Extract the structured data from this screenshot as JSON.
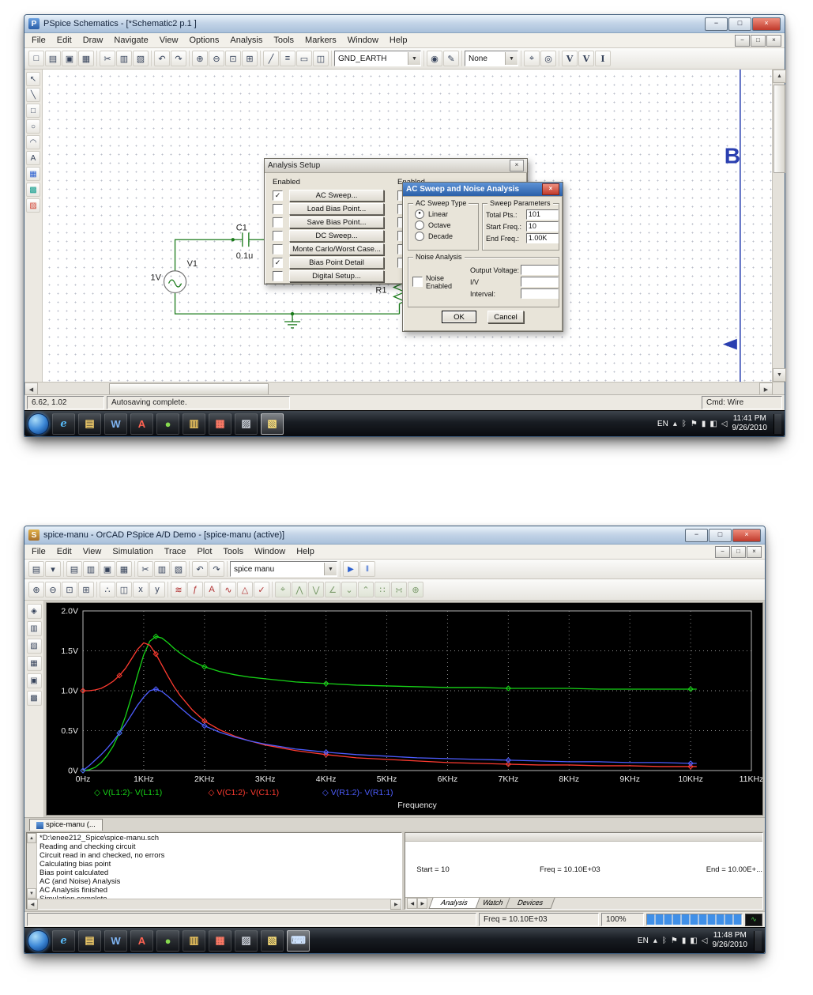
{
  "chart_data": {
    "type": "line",
    "title": "",
    "xlabel": "Frequency",
    "ylabel": "",
    "xlim": [
      0,
      11
    ],
    "ylim": [
      0,
      2
    ],
    "grid": "dotted",
    "legend_position": "bottom-inside",
    "plot_bg": "#000000",
    "x_ticks": [
      "0Hz",
      "1KHz",
      "2KHz",
      "3KHz",
      "4KHz",
      "5KHz",
      "6KHz",
      "7KHz",
      "8KHz",
      "9KHz",
      "10KHz",
      "11KHz"
    ],
    "y_ticks": [
      "0V",
      "0.5V",
      "1.0V",
      "1.5V",
      "2.0V"
    ],
    "x": [
      0,
      0.1,
      0.2,
      0.3,
      0.4,
      0.5,
      0.6,
      0.7,
      0.8,
      0.9,
      1.0,
      1.1,
      1.2,
      1.3,
      1.4,
      1.5,
      1.6,
      1.8,
      2.0,
      2.25,
      2.5,
      2.75,
      3.0,
      3.5,
      4.0,
      4.5,
      5.0,
      5.5,
      6.0,
      6.5,
      7.0,
      7.5,
      8.0,
      8.5,
      9.0,
      9.5,
      10.0,
      10.1
    ],
    "series": [
      {
        "name": "V(L1:2)- V(L1:1)",
        "color": "#17d417",
        "values": [
          0,
          0.01,
          0.04,
          0.1,
          0.19,
          0.31,
          0.47,
          0.68,
          0.93,
          1.2,
          1.45,
          1.62,
          1.68,
          1.66,
          1.6,
          1.53,
          1.47,
          1.37,
          1.3,
          1.24,
          1.2,
          1.17,
          1.15,
          1.11,
          1.09,
          1.07,
          1.06,
          1.05,
          1.04,
          1.04,
          1.03,
          1.03,
          1.03,
          1.02,
          1.02,
          1.02,
          1.02,
          1.02
        ]
      },
      {
        "name": "V(C1:2)- V(C1:1)",
        "color": "#ff3b30",
        "values": [
          1.0,
          1.0,
          1.01,
          1.03,
          1.07,
          1.12,
          1.19,
          1.28,
          1.4,
          1.52,
          1.6,
          1.57,
          1.46,
          1.32,
          1.18,
          1.05,
          0.94,
          0.76,
          0.62,
          0.51,
          0.43,
          0.37,
          0.32,
          0.25,
          0.2,
          0.16,
          0.14,
          0.12,
          0.1,
          0.09,
          0.08,
          0.07,
          0.07,
          0.06,
          0.06,
          0.05,
          0.05,
          0.05
        ]
      },
      {
        "name": "V(R1:2)- V(R1:1)",
        "color": "#4d5dff",
        "values": [
          0,
          0.06,
          0.13,
          0.2,
          0.28,
          0.37,
          0.47,
          0.58,
          0.7,
          0.82,
          0.92,
          1.0,
          1.02,
          0.99,
          0.93,
          0.86,
          0.79,
          0.66,
          0.56,
          0.48,
          0.42,
          0.37,
          0.33,
          0.27,
          0.23,
          0.2,
          0.18,
          0.16,
          0.15,
          0.14,
          0.13,
          0.12,
          0.11,
          0.11,
          0.1,
          0.1,
          0.09,
          0.09
        ]
      }
    ]
  },
  "shot1": {
    "titlebar": {
      "title": "PSpice Schematics - [*Schematic2  p.1  ]",
      "app_initial": "P",
      "min": "−",
      "max": "□",
      "close": "×"
    },
    "menu": [
      "File",
      "Edit",
      "Draw",
      "Navigate",
      "View",
      "Options",
      "Analysis",
      "Tools",
      "Markers",
      "Window",
      "Help"
    ],
    "mdi": {
      "min": "−",
      "restore": "□",
      "close": "×"
    },
    "toolbar_file": [
      {
        "name": "new-icon",
        "glyph": "□"
      },
      {
        "name": "open-icon",
        "glyph": "▤"
      },
      {
        "name": "save-icon",
        "glyph": "▣"
      },
      {
        "name": "print-icon",
        "glyph": "▦"
      }
    ],
    "toolbar_edit": [
      {
        "name": "cut-icon",
        "glyph": "✂"
      },
      {
        "name": "copy-icon",
        "glyph": "▥"
      },
      {
        "name": "paste-icon",
        "glyph": "▧"
      }
    ],
    "toolbar_undo": [
      {
        "name": "undo-icon",
        "glyph": "↶"
      },
      {
        "name": "redo-icon",
        "glyph": "↷"
      }
    ],
    "toolbar_zoom": [
      {
        "name": "zoom-in-icon",
        "glyph": "⊕"
      },
      {
        "name": "zoom-out-icon",
        "glyph": "⊖"
      },
      {
        "name": "zoom-area-icon",
        "glyph": "⊡"
      },
      {
        "name": "zoom-fit-icon",
        "glyph": "⊞"
      }
    ],
    "toolbar_draw": [
      {
        "name": "draw-wire-icon",
        "glyph": "╱"
      },
      {
        "name": "draw-bus-icon",
        "glyph": "≡"
      },
      {
        "name": "draw-block-icon",
        "glyph": "▭"
      },
      {
        "name": "edit-symbol-icon",
        "glyph": "◫"
      }
    ],
    "part_combo": {
      "value": "GND_EARTH"
    },
    "toolbar_part": [
      {
        "name": "get-part-icon",
        "glyph": "◉"
      },
      {
        "name": "edit-attributes-icon",
        "glyph": "✎"
      }
    ],
    "marker_combo": {
      "value": "None"
    },
    "toolbar_search": [
      {
        "name": "find-part-icon",
        "glyph": "⌖"
      },
      {
        "name": "find-next-icon",
        "glyph": "◎"
      }
    ],
    "toolbar_markers": [
      {
        "name": "voltage-marker-icon",
        "glyph": "V"
      },
      {
        "name": "voltage-diff-marker-icon",
        "glyph": "V"
      },
      {
        "name": "current-marker-icon",
        "glyph": "I"
      }
    ],
    "left_toolbar": [
      {
        "name": "select-tool-icon",
        "glyph": "↖"
      },
      {
        "name": "draw-line-icon",
        "glyph": "╲"
      },
      {
        "name": "draw-box-icon",
        "glyph": "□"
      },
      {
        "name": "draw-circle-icon",
        "glyph": "○"
      },
      {
        "name": "draw-arc-icon",
        "glyph": "◠"
      },
      {
        "name": "draw-text-icon",
        "glyph": "A"
      },
      {
        "name": "part-browser-icon",
        "glyph": "▦"
      },
      {
        "name": "symbol-editor-icon",
        "glyph": "▩"
      },
      {
        "name": "simulate-icon",
        "glyph": "▨"
      }
    ],
    "canvas": {
      "page_letter": "B",
      "v1_ref": "V1",
      "v1_value": "1V",
      "c1_ref": "C1",
      "c1_value": "0.1u",
      "r1_ref": "R1"
    },
    "analysis_setup": {
      "title": "Analysis Setup",
      "close": "×",
      "col1_header": "Enabled",
      "col2_header": "Enabled",
      "rows": [
        {
          "check": "✓",
          "label": "AC Sweep..."
        },
        {
          "check": "",
          "label": "Load Bias Point..."
        },
        {
          "check": "",
          "label": "Save Bias Point..."
        },
        {
          "check": "",
          "label": "DC Sweep..."
        },
        {
          "check": "",
          "label": "Monte Carlo/Worst Case..."
        },
        {
          "check": "✓",
          "label": "Bias Point Detail"
        },
        {
          "check": "",
          "label": "Digital Setup..."
        }
      ],
      "rows2": [
        "",
        "",
        "",
        "",
        "",
        ""
      ]
    },
    "ac_dialog": {
      "title": "AC Sweep and Noise Analysis",
      "close": "×",
      "sweep_type_group": "AC Sweep Type",
      "radios": [
        {
          "dot": "●",
          "label": "Linear"
        },
        {
          "dot": "",
          "label": "Octave"
        },
        {
          "dot": "",
          "label": "Decade"
        }
      ],
      "params_group": "Sweep Parameters",
      "params": [
        {
          "label": "Total Pts.:",
          "value": "101"
        },
        {
          "label": "Start Freq.:",
          "value": "10"
        },
        {
          "label": "End Freq.:",
          "value": "1.00K"
        }
      ],
      "noise_group": "Noise Analysis",
      "noise_check": "",
      "noise_check_label": "Noise Enabled",
      "noise_fields": [
        {
          "label": "Output Voltage:",
          "value": ""
        },
        {
          "label": "I/V",
          "value": ""
        },
        {
          "label": "Interval:",
          "value": ""
        }
      ],
      "ok": "OK",
      "cancel": "Cancel"
    },
    "status": {
      "coords": "6.62,  1.02",
      "message": "Autosaving complete.",
      "cmd": "Cmd: Wire"
    },
    "taskbar_icons": [
      {
        "name": "ie-icon",
        "glyph": "e"
      },
      {
        "name": "explorer-icon",
        "glyph": "▤"
      },
      {
        "name": "word-icon",
        "glyph": "W"
      },
      {
        "name": "adobe-reader-icon",
        "glyph": "A"
      },
      {
        "name": "updater-icon",
        "glyph": "●"
      },
      {
        "name": "documents-icon",
        "glyph": "▥"
      },
      {
        "name": "toolbox-icon",
        "glyph": "▦"
      },
      {
        "name": "chart-app-icon",
        "glyph": "▨"
      },
      {
        "name": "pspice-schematics-task-icon",
        "glyph": "▧"
      }
    ],
    "tray": {
      "lang": "EN",
      "chevron": "▴",
      "icons": [
        {
          "name": "bluetooth-icon",
          "glyph": "ᛒ"
        },
        {
          "name": "action-center-icon",
          "glyph": "⚑"
        },
        {
          "name": "power-icon",
          "glyph": "▮"
        },
        {
          "name": "network-icon",
          "glyph": "◧"
        },
        {
          "name": "volume-icon",
          "glyph": "◁"
        }
      ],
      "time": "11:41 PM",
      "date": "9/26/2010"
    }
  },
  "shot2": {
    "titlebar": {
      "title": "spice-manu - OrCAD PSpice A/D Demo  - [spice-manu (active)]",
      "app_initial": "S",
      "min": "−",
      "max": "□",
      "close": "×"
    },
    "menu": [
      "File",
      "Edit",
      "View",
      "Simulation",
      "Trace",
      "Plot",
      "Tools",
      "Window",
      "Help"
    ],
    "mdi": {
      "min": "−",
      "restore": "□",
      "close": "×"
    },
    "toolbar_profile": [
      {
        "name": "new-profile-icon",
        "glyph": "▤"
      },
      {
        "name": "profile-dropdown-icon",
        "glyph": "▾"
      }
    ],
    "toolbar_file": [
      {
        "name": "open-icon",
        "glyph": "▤"
      },
      {
        "name": "append-icon",
        "glyph": "▥"
      },
      {
        "name": "save-icon",
        "glyph": "▣"
      },
      {
        "name": "print-icon",
        "glyph": "▦"
      }
    ],
    "toolbar_edit": [
      {
        "name": "cut-icon",
        "glyph": "✂"
      },
      {
        "name": "copy-icon",
        "glyph": "▥"
      },
      {
        "name": "paste-icon",
        "glyph": "▧"
      }
    ],
    "toolbar_undo": [
      {
        "name": "undo-icon",
        "glyph": "↶"
      },
      {
        "name": "redo-icon",
        "glyph": "↷"
      }
    ],
    "profile_combo": {
      "value": "spice manu"
    },
    "toolbar_run": [
      {
        "name": "run-simulation-icon",
        "glyph": "▶"
      },
      {
        "name": "pause-simulation-icon",
        "glyph": "‖"
      }
    ],
    "toolbar_zoom": [
      {
        "name": "zoom-in-icon",
        "glyph": "⊕"
      },
      {
        "name": "zoom-out-icon",
        "glyph": "⊖"
      },
      {
        "name": "zoom-area-icon",
        "glyph": "⊡"
      },
      {
        "name": "zoom-fit-icon",
        "glyph": "⊞"
      }
    ],
    "toolbar_plot": [
      {
        "name": "mark-data-points-icon",
        "glyph": "∴"
      },
      {
        "name": "show-plots-icon",
        "glyph": "◫"
      },
      {
        "name": "log-x-axis-icon",
        "glyph": "x"
      },
      {
        "name": "log-y-axis-icon",
        "glyph": "y"
      }
    ],
    "toolbar_trace": [
      {
        "name": "add-trace-icon",
        "glyph": "≋"
      },
      {
        "name": "eval-function-icon",
        "glyph": "ƒ"
      },
      {
        "name": "text-label-icon",
        "glyph": "A"
      },
      {
        "name": "fourier-icon",
        "glyph": "∿"
      },
      {
        "name": "performance-analysis-icon",
        "glyph": "△"
      },
      {
        "name": "goal-function-icon",
        "glyph": "✓"
      }
    ],
    "toolbar_cursor": [
      {
        "name": "toggle-cursor-icon",
        "glyph": "⌖"
      },
      {
        "name": "cursor-peak-icon",
        "glyph": "⋀"
      },
      {
        "name": "cursor-trough-icon",
        "glyph": "⋁"
      },
      {
        "name": "cursor-slope-icon",
        "glyph": "∠"
      },
      {
        "name": "cursor-min-icon",
        "glyph": "⌄"
      },
      {
        "name": "cursor-max-icon",
        "glyph": "⌃"
      },
      {
        "name": "cursor-point-icon",
        "glyph": "∷"
      },
      {
        "name": "cursor-search-icon",
        "glyph": "∺"
      },
      {
        "name": "mark-label-icon",
        "glyph": "⊕"
      }
    ],
    "left_toolbar": [
      {
        "name": "workbook-icon",
        "glyph": "◈"
      },
      {
        "name": "copy-icon",
        "glyph": "▥"
      },
      {
        "name": "paste-icon",
        "glyph": "▧"
      },
      {
        "name": "print-plot-icon",
        "glyph": "▦"
      },
      {
        "name": "save-plot-icon",
        "glyph": "▣"
      },
      {
        "name": "grid-icon",
        "glyph": "▩"
      }
    ],
    "plot_tab": "spice-manu (...",
    "output_log": [
      "*D:\\enee212_Spice\\spice-manu.sch",
      "Reading and checking circuit",
      "Circuit read in and checked, no errors",
      "Calculating bias point",
      "Bias point calculated",
      "AC (and Noise) Analysis",
      "AC Analysis finished",
      "Simulation complete"
    ],
    "sim_panel": {
      "start": "Start =  10",
      "freq": "Freq = 10.10E+03",
      "end": "End = 10.00E+..."
    },
    "bottom_tabs": [
      "Analysis",
      "Watch",
      "Devices"
    ],
    "status": {
      "freq": "Freq = 10.10E+03",
      "zoom": "100%"
    },
    "taskbar_icons": [
      {
        "name": "ie-icon",
        "glyph": "e"
      },
      {
        "name": "explorer-icon",
        "glyph": "▤"
      },
      {
        "name": "word-icon",
        "glyph": "W"
      },
      {
        "name": "adobe-reader-icon",
        "glyph": "A"
      },
      {
        "name": "updater-icon",
        "glyph": "●"
      },
      {
        "name": "documents-icon",
        "glyph": "▥"
      },
      {
        "name": "toolbox-icon",
        "glyph": "▦"
      },
      {
        "name": "chart-app-icon",
        "glyph": "▨"
      },
      {
        "name": "pspice-ad-task-icon",
        "glyph": "▧"
      },
      {
        "name": "onscreen-keyboard-icon",
        "glyph": "⌨"
      }
    ],
    "tray": {
      "lang": "EN",
      "chevron": "▴",
      "icons": [
        {
          "name": "bluetooth-icon",
          "glyph": "ᛒ"
        },
        {
          "name": "action-center-icon",
          "glyph": "⚑"
        },
        {
          "name": "power-icon",
          "glyph": "▮"
        },
        {
          "name": "network-icon",
          "glyph": "◧"
        },
        {
          "name": "volume-icon",
          "glyph": "◁"
        }
      ],
      "time": "11:48 PM",
      "date": "9/26/2010"
    }
  }
}
